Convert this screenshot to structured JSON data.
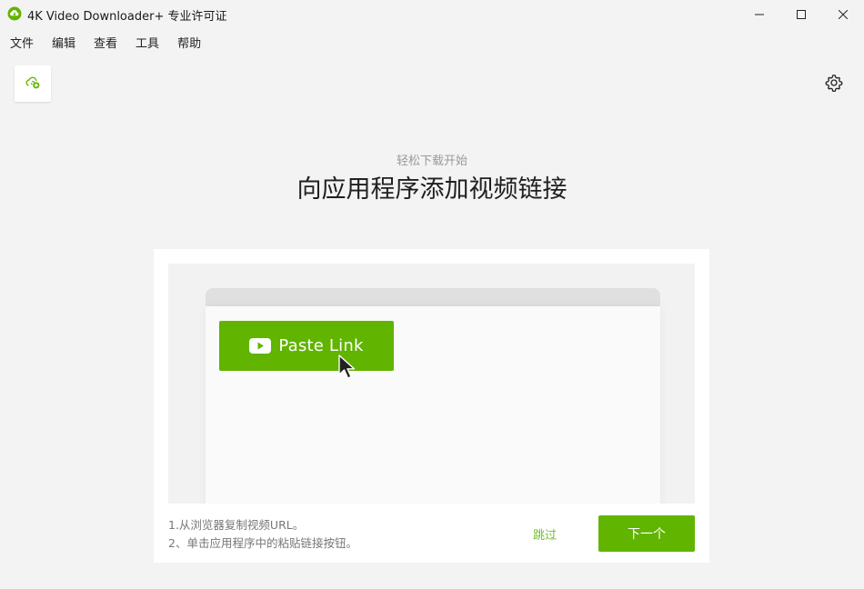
{
  "window": {
    "title": "4K Video Downloader+ 专业许可证"
  },
  "menu": {
    "items": [
      "文件",
      "编辑",
      "查看",
      "工具",
      "帮助"
    ]
  },
  "icons": {
    "app_logo": "cloud-download-logo-icon",
    "add_link": "add-link-icon",
    "settings": "gear-icon",
    "minimize": "minimize-icon",
    "maximize": "maximize-icon",
    "close": "close-icon",
    "youtube": "youtube-icon",
    "cursor": "mouse-cursor-icon"
  },
  "colors": {
    "accent": "#61b400",
    "skip_text": "#6fbf2a"
  },
  "intro": {
    "subtitle": "轻松下载开始",
    "heading": "向应用程序添加视频链接"
  },
  "illustration": {
    "paste_button_label": "Paste Link"
  },
  "instructions": {
    "step1": "1.从浏览器复制视频URL。",
    "step2": "2、单击应用程序中的粘贴链接按钮。"
  },
  "actions": {
    "skip_label": "跳过",
    "next_label": "下一个"
  }
}
